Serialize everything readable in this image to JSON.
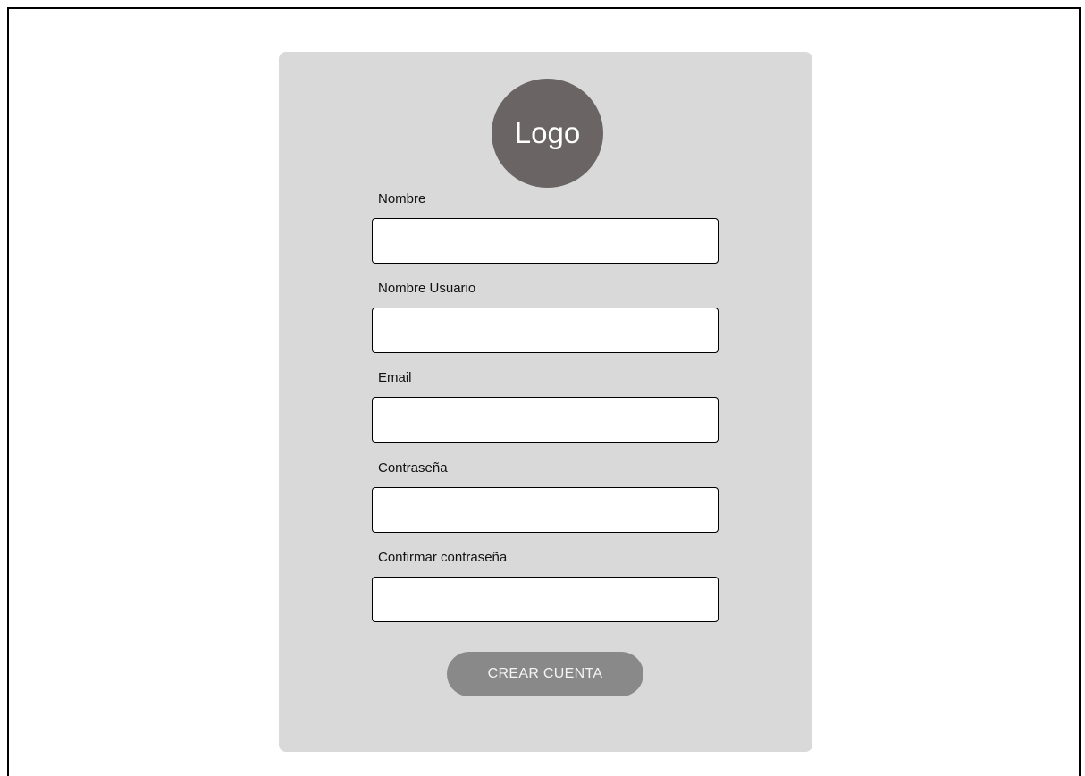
{
  "logo": {
    "text": "Logo"
  },
  "form": {
    "fields": [
      {
        "label": "Nombre",
        "value": "",
        "placeholder": ""
      },
      {
        "label": "Nombre Usuario",
        "value": "",
        "placeholder": ""
      },
      {
        "label": "Email",
        "value": "",
        "placeholder": ""
      },
      {
        "label": "Contraseña",
        "value": "",
        "placeholder": ""
      },
      {
        "label": "Confirmar contraseña",
        "value": "",
        "placeholder": ""
      }
    ],
    "submit_label": "CREAR CUENTA"
  },
  "colors": {
    "card_background": "#d9d9d9",
    "logo_background": "#6a6564",
    "button_background": "#898989",
    "button_text": "#f4f4f4"
  }
}
